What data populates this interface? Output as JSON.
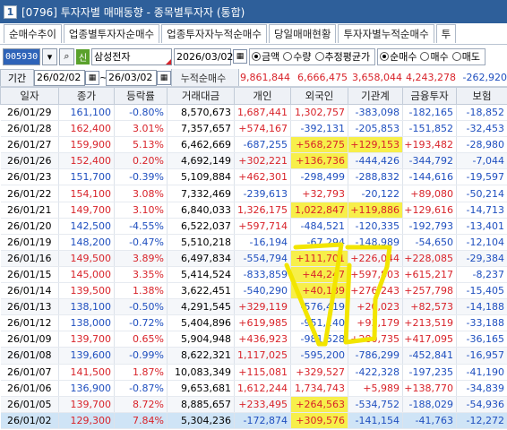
{
  "window": {
    "code": "1",
    "title": "[0796] 투자자별 매매동향 - 종목별투자자 (통합)"
  },
  "tabs": [
    "순매수추이",
    "업종별투자자순매수",
    "업종투자자누적순매수",
    "당일매매현황",
    "투자자별누적순매수",
    "투"
  ],
  "toolbar": {
    "stock_code": "005930",
    "search_glyph": "⌕",
    "credit_badge": "신",
    "stock_name": "삼성전자",
    "date": "2026/03/02",
    "calendar_glyph": "▦",
    "unit_options": [
      "금액",
      "수량",
      "추정평균가"
    ],
    "unit_selected": 0,
    "side_options": [
      "순매수",
      "매수",
      "매도"
    ],
    "side_selected": 0
  },
  "period": {
    "label": "기간",
    "from": "26/02/02",
    "separator": "~",
    "to": "26/03/02",
    "sum_label": "누적순매수",
    "sums": [
      "9,861,844",
      "6,666,475",
      "3,658,044",
      "4,243,278",
      "-262,920"
    ]
  },
  "columns": [
    "일자",
    "종가",
    "등락률",
    "거래대금",
    "개인",
    "외국인",
    "기관계",
    "금융투자",
    "보험"
  ],
  "rows": [
    [
      "26/01/29",
      "161,100",
      "-0.80%",
      "8,570,673",
      "1,687,441",
      "1,302,757",
      "-383,098",
      "-182,165",
      "-18,852"
    ],
    [
      "26/01/28",
      "162,400",
      "3.01%",
      "7,357,657",
      "+574,167",
      "-392,131",
      "-205,853",
      "-151,852",
      "-32,453"
    ],
    [
      "26/01/27",
      "159,900",
      "5.13%",
      "6,462,669",
      "-687,255",
      "+568,275",
      "+129,153",
      "+193,482",
      "-28,980"
    ],
    [
      "26/01/26",
      "152,400",
      "0.20%",
      "4,692,149",
      "+302,221",
      "+136,736",
      "-444,426",
      "-344,792",
      "-7,044"
    ],
    [
      "26/01/23",
      "151,700",
      "-0.39%",
      "5,109,884",
      "+462,301",
      "-298,499",
      "-288,832",
      "-144,616",
      "-19,597"
    ],
    [
      "26/01/22",
      "154,100",
      "3.08%",
      "7,332,469",
      "-239,613",
      "+32,793",
      "-20,122",
      "+89,080",
      "-50,214"
    ],
    [
      "26/01/21",
      "149,700",
      "3.10%",
      "6,840,033",
      "1,326,175",
      "1,022,847",
      "+119,886",
      "+129,616",
      "-14,713"
    ],
    [
      "26/01/20",
      "142,500",
      "-4.55%",
      "6,522,037",
      "+597,714",
      "-484,521",
      "-120,335",
      "-192,793",
      "-13,401"
    ],
    [
      "26/01/19",
      "148,200",
      "-0.47%",
      "5,510,218",
      "-16,194",
      "-67,294",
      "-148,989",
      "-54,650",
      "-12,104"
    ],
    [
      "26/01/16",
      "149,500",
      "3.89%",
      "6,497,834",
      "-554,794",
      "+111,701",
      "+226,044",
      "+228,085",
      "-29,384"
    ],
    [
      "26/01/15",
      "145,000",
      "3.35%",
      "5,414,524",
      "-833,859",
      "+44,247",
      "+597,803",
      "+615,217",
      "-8,237"
    ],
    [
      "26/01/14",
      "139,500",
      "1.38%",
      "3,622,451",
      "-540,290",
      "+40,139",
      "+276,243",
      "+257,798",
      "-15,405"
    ],
    [
      "26/01/13",
      "138,100",
      "-0.50%",
      "4,291,545",
      "+329,119",
      "-576,419",
      "+20,023",
      "+82,573",
      "-14,188"
    ],
    [
      "26/01/12",
      "138,000",
      "-0.72%",
      "5,404,896",
      "+619,985",
      "-951,140",
      "+93,179",
      "+213,519",
      "-33,188"
    ],
    [
      "26/01/09",
      "139,700",
      "0.65%",
      "5,904,948",
      "+436,923",
      "-981,528",
      "+280,735",
      "+417,095",
      "-36,165"
    ],
    [
      "26/01/08",
      "139,600",
      "-0.99%",
      "8,622,321",
      "1,117,025",
      "-595,200",
      "-786,299",
      "-452,841",
      "-16,957"
    ],
    [
      "26/01/07",
      "141,500",
      "1.87%",
      "10,083,349",
      "+115,081",
      "+329,527",
      "-422,328",
      "-197,235",
      "-41,190"
    ],
    [
      "26/01/06",
      "136,900",
      "-0.87%",
      "9,653,681",
      "1,612,244",
      "1,734,743",
      "+5,989",
      "+138,770",
      "-34,839"
    ],
    [
      "26/01/05",
      "139,700",
      "8.72%",
      "8,885,657",
      "+233,495",
      "+264,563",
      "-534,752",
      "-188,029",
      "-54,936"
    ],
    [
      "26/01/02",
      "129,300",
      "7.84%",
      "5,304,236",
      "-172,874",
      "+309,576",
      "-141,154",
      "-41,763",
      "-12,272"
    ]
  ],
  "highlight_color": "#f7ef4a",
  "annotation_color": "#f2e500",
  "up_color": "#d8232a",
  "down_color": "#1f4fbf"
}
